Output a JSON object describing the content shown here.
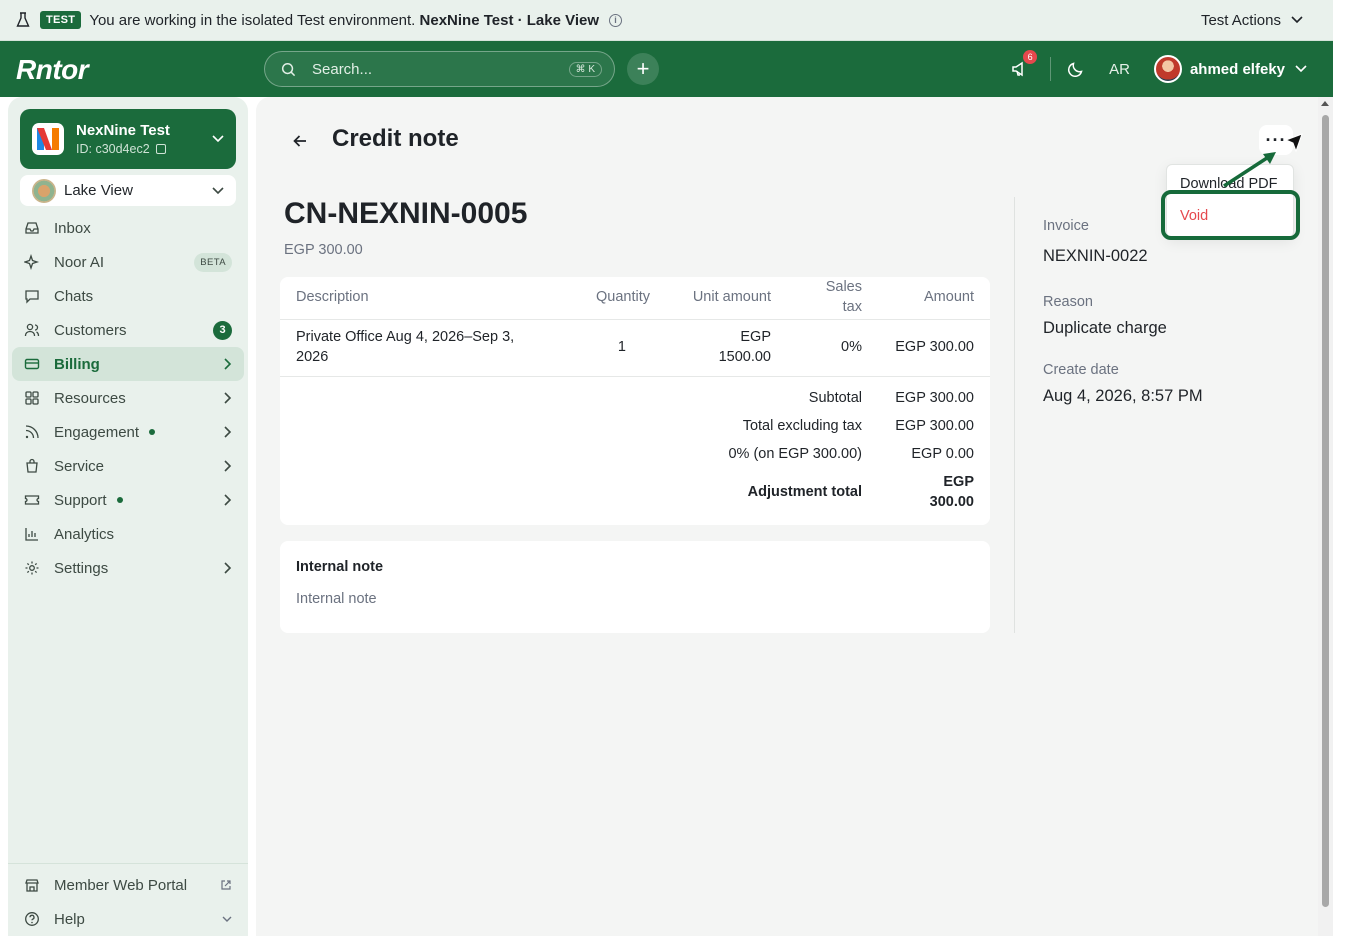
{
  "banner": {
    "badge": "TEST",
    "message": "You are working in the isolated Test environment.",
    "environment": "NexNine Test · Lake View",
    "actions_label": "Test Actions"
  },
  "topbar": {
    "logo": "Rntor",
    "search_placeholder": "Search...",
    "search_shortcut": "⌘ K",
    "notifications_count": "6",
    "language": "AR",
    "user_name": "ahmed elfeky"
  },
  "sidebar": {
    "org_name": "NexNine Test",
    "org_id": "ID: c30d4ec2",
    "location": "Lake View",
    "items": [
      {
        "label": "Inbox"
      },
      {
        "label": "Noor AI",
        "badge": "BETA"
      },
      {
        "label": "Chats"
      },
      {
        "label": "Customers",
        "count": "3"
      },
      {
        "label": "Billing"
      },
      {
        "label": "Resources"
      },
      {
        "label": "Engagement"
      },
      {
        "label": "Service"
      },
      {
        "label": "Support"
      },
      {
        "label": "Analytics"
      },
      {
        "label": "Settings"
      }
    ],
    "bottom": [
      {
        "label": "Member Web Portal"
      },
      {
        "label": "Help"
      }
    ]
  },
  "page": {
    "title": "Credit note",
    "number": "CN-NEXNIN-0005",
    "amount": "EGP 300.00"
  },
  "table": {
    "headers": {
      "description": "Description",
      "quantity": "Quantity",
      "unit_amount": "Unit amount",
      "sales_tax_1": "Sales",
      "sales_tax_2": "tax",
      "amount": "Amount"
    },
    "rows": [
      {
        "description_1": "Private Office Aug 4, 2026–Sep 3,",
        "description_2": "2026",
        "quantity": "1",
        "unit_amount_1": "EGP",
        "unit_amount_2": "1500.00",
        "sales_tax": "0%",
        "amount": "EGP 300.00"
      }
    ],
    "totals": {
      "subtotal_label": "Subtotal",
      "subtotal_value": "EGP 300.00",
      "excl_label": "Total excluding tax",
      "excl_value": "EGP 300.00",
      "tax_label": "0% (on EGP 300.00)",
      "tax_value": "EGP 0.00",
      "adjust_label": "Adjustment total",
      "adjust_value_1": "EGP",
      "adjust_value_2": "300.00"
    }
  },
  "internal_note": {
    "title": "Internal note",
    "placeholder": "Internal note"
  },
  "meta": {
    "invoice_label": "Invoice",
    "invoice_value": "NEXNIN-0022",
    "reason_label": "Reason",
    "reason_value": "Duplicate charge",
    "date_label": "Create date",
    "date_value": "Aug 4, 2026, 8:57 PM"
  },
  "menu": {
    "more_label": "···",
    "download_pdf": "Download PDF",
    "void": "Void"
  },
  "colors": {
    "brand": "#1b6b3c",
    "danger": "#e5484d",
    "annotation": "#166a3a"
  }
}
